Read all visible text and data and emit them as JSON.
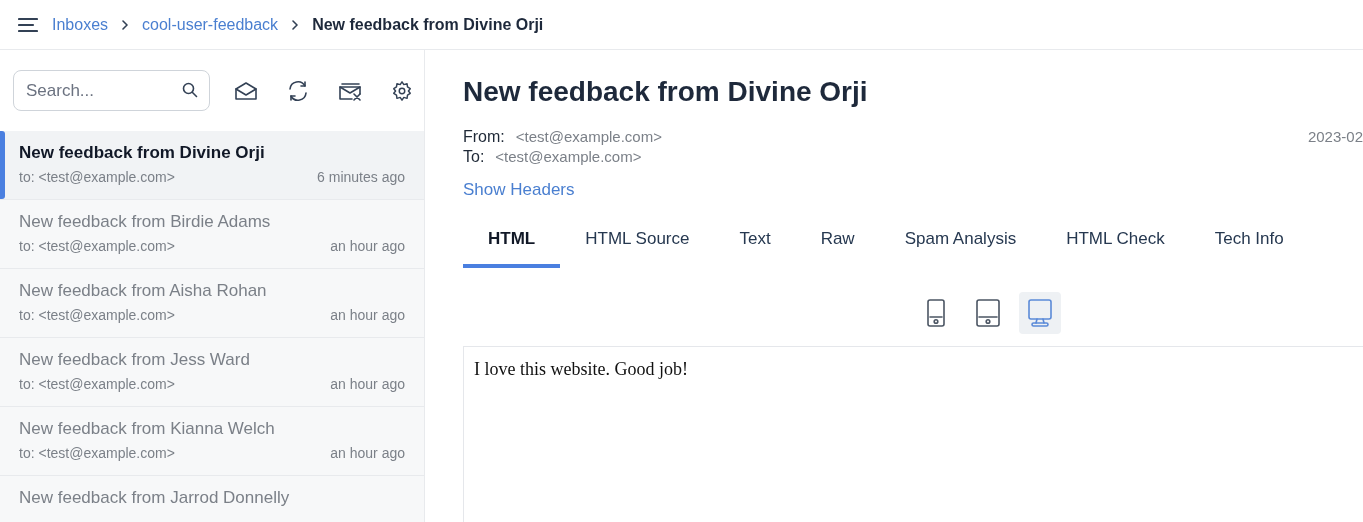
{
  "breadcrumb": [
    {
      "label": "Inboxes",
      "kind": "link"
    },
    {
      "label": "cool-user-feedback",
      "kind": "link"
    },
    {
      "label": "New feedback from Divine Orji",
      "kind": "current"
    }
  ],
  "search": {
    "placeholder": "Search..."
  },
  "messages": [
    {
      "subject": "New feedback from Divine Orji",
      "to": "to: <test@example.com>",
      "time": "6 minutes ago",
      "selected": true
    },
    {
      "subject": "New feedback from Birdie Adams",
      "to": "to: <test@example.com>",
      "time": "an hour ago",
      "selected": false
    },
    {
      "subject": "New feedback from Aisha Rohan",
      "to": "to: <test@example.com>",
      "time": "an hour ago",
      "selected": false
    },
    {
      "subject": "New feedback from Jess Ward",
      "to": "to: <test@example.com>",
      "time": "an hour ago",
      "selected": false
    },
    {
      "subject": "New feedback from Kianna Welch",
      "to": "to: <test@example.com>",
      "time": "an hour ago",
      "selected": false
    },
    {
      "subject": "New feedback from Jarrod Donnelly",
      "selected": false
    }
  ],
  "message": {
    "title": "New feedback from Divine Orji",
    "from_label": "From:",
    "from": "<test@example.com>",
    "to_label": "To:",
    "to": "<test@example.com>",
    "date": "2023-02",
    "show_headers": "Show Headers"
  },
  "tabs": [
    {
      "label": "HTML",
      "selected": true
    },
    {
      "label": "HTML Source",
      "selected": false
    },
    {
      "label": "Text",
      "selected": false
    },
    {
      "label": "Raw",
      "selected": false
    },
    {
      "label": "Spam Analysis",
      "selected": false
    },
    {
      "label": "HTML Check",
      "selected": false
    },
    {
      "label": "Tech Info",
      "selected": false
    }
  ],
  "devices": [
    {
      "kind": "phone",
      "selected": false
    },
    {
      "kind": "tablet",
      "selected": false
    },
    {
      "kind": "desktop",
      "selected": true
    }
  ],
  "body": "I love this website. Good job!"
}
